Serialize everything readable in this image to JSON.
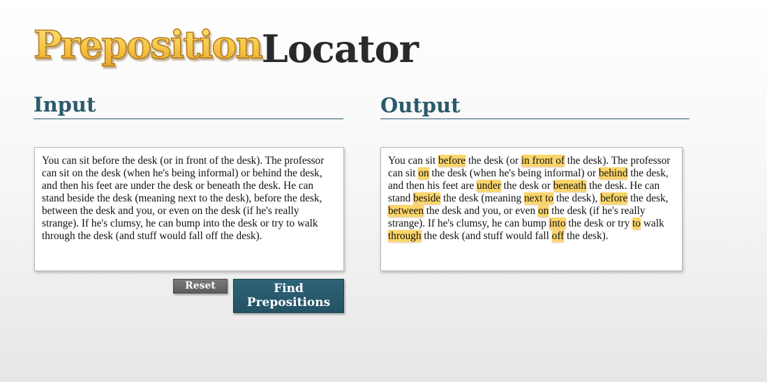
{
  "logo": {
    "word1": "Preposition",
    "word2": "Locator"
  },
  "input": {
    "heading": "Input",
    "text": "You can sit before the desk (or in front of the desk). The professor can sit on the desk (when he's being informal) or behind the desk, and then his feet are under the desk or beneath the desk. He can stand beside the desk (meaning next to the desk), before the desk, between the desk and you, or even on the desk (if he's really strange). If he's clumsy, he can bump into the desk or try to walk through the desk (and stuff would fall off the desk)."
  },
  "buttons": {
    "reset": "Reset",
    "find_line1": "Find",
    "find_line2": "Prepositions"
  },
  "output": {
    "heading": "Output",
    "segments": [
      {
        "text": "You can sit ",
        "highlight": false
      },
      {
        "text": "before",
        "highlight": true
      },
      {
        "text": " the desk (or ",
        "highlight": false
      },
      {
        "text": "in front of",
        "highlight": true
      },
      {
        "text": " the desk). The professor can sit ",
        "highlight": false
      },
      {
        "text": "on",
        "highlight": true
      },
      {
        "text": " the desk (when he's being informal) or ",
        "highlight": false
      },
      {
        "text": "behind",
        "highlight": true
      },
      {
        "text": " the desk, and then his feet are ",
        "highlight": false
      },
      {
        "text": "under",
        "highlight": true
      },
      {
        "text": " the desk or ",
        "highlight": false
      },
      {
        "text": "beneath",
        "highlight": true
      },
      {
        "text": " the desk. He can stand ",
        "highlight": false
      },
      {
        "text": "beside",
        "highlight": true
      },
      {
        "text": " the desk (meaning ",
        "highlight": false
      },
      {
        "text": "next to",
        "highlight": true
      },
      {
        "text": " the desk), ",
        "highlight": false
      },
      {
        "text": "before",
        "highlight": true
      },
      {
        "text": " the desk, ",
        "highlight": false
      },
      {
        "text": "between",
        "highlight": true
      },
      {
        "text": " the desk and you, or even ",
        "highlight": false
      },
      {
        "text": "on",
        "highlight": true
      },
      {
        "text": " the desk (if he's really strange). If he's clumsy, he can bump ",
        "highlight": false
      },
      {
        "text": "into",
        "highlight": true
      },
      {
        "text": " the desk or try ",
        "highlight": false
      },
      {
        "text": "to",
        "highlight": true
      },
      {
        "text": " walk ",
        "highlight": false
      },
      {
        "text": "through",
        "highlight": true
      },
      {
        "text": " the desk (and stuff would fall ",
        "highlight": false
      },
      {
        "text": "off",
        "highlight": true
      },
      {
        "text": " the desk).",
        "highlight": false
      }
    ]
  },
  "colors": {
    "heading": "#2b5a6b",
    "highlight": "#fbd56a",
    "find_button": "#2a5c70",
    "reset_button": "#6b6b6b"
  }
}
